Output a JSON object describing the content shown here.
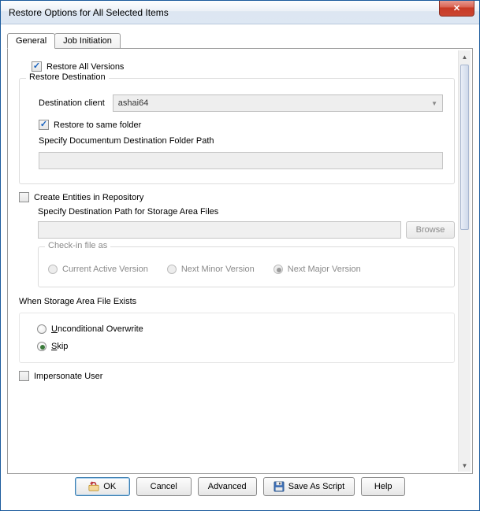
{
  "window": {
    "title": "Restore Options for All Selected Items"
  },
  "tabs": {
    "general": "General",
    "job_initiation": "Job Initiation"
  },
  "restore_all_versions": {
    "label": "Restore All Versions",
    "checked": true
  },
  "restore_destination": {
    "legend": "Restore Destination",
    "destination_client_label": "Destination client",
    "destination_client_value": "ashai64",
    "restore_same_folder_label": "Restore to same folder",
    "restore_same_folder_checked": true,
    "specify_docu_path_label": "Specify Documentum Destination Folder Path",
    "specify_docu_path_value": ""
  },
  "create_entities": {
    "label": "Create Entities in Repository",
    "checked": false,
    "specify_storage_path_label": "Specify Destination Path for Storage Area Files",
    "specify_storage_path_value": "",
    "browse_label": "Browse",
    "checkin_legend": "Check-in file as",
    "options": {
      "current": "Current Active Version",
      "minor": "Next Minor Version",
      "major": "Next Major Version"
    },
    "selected": "major"
  },
  "when_exists": {
    "legend": "When Storage Area File Exists",
    "options": {
      "overwrite": "Unconditional Overwrite",
      "skip": "Skip"
    },
    "selected": "skip"
  },
  "impersonate": {
    "label": "Impersonate User",
    "checked": false
  },
  "buttons": {
    "ok": "OK",
    "cancel": "Cancel",
    "advanced": "Advanced",
    "save_as_script": "Save As Script",
    "help": "Help"
  }
}
